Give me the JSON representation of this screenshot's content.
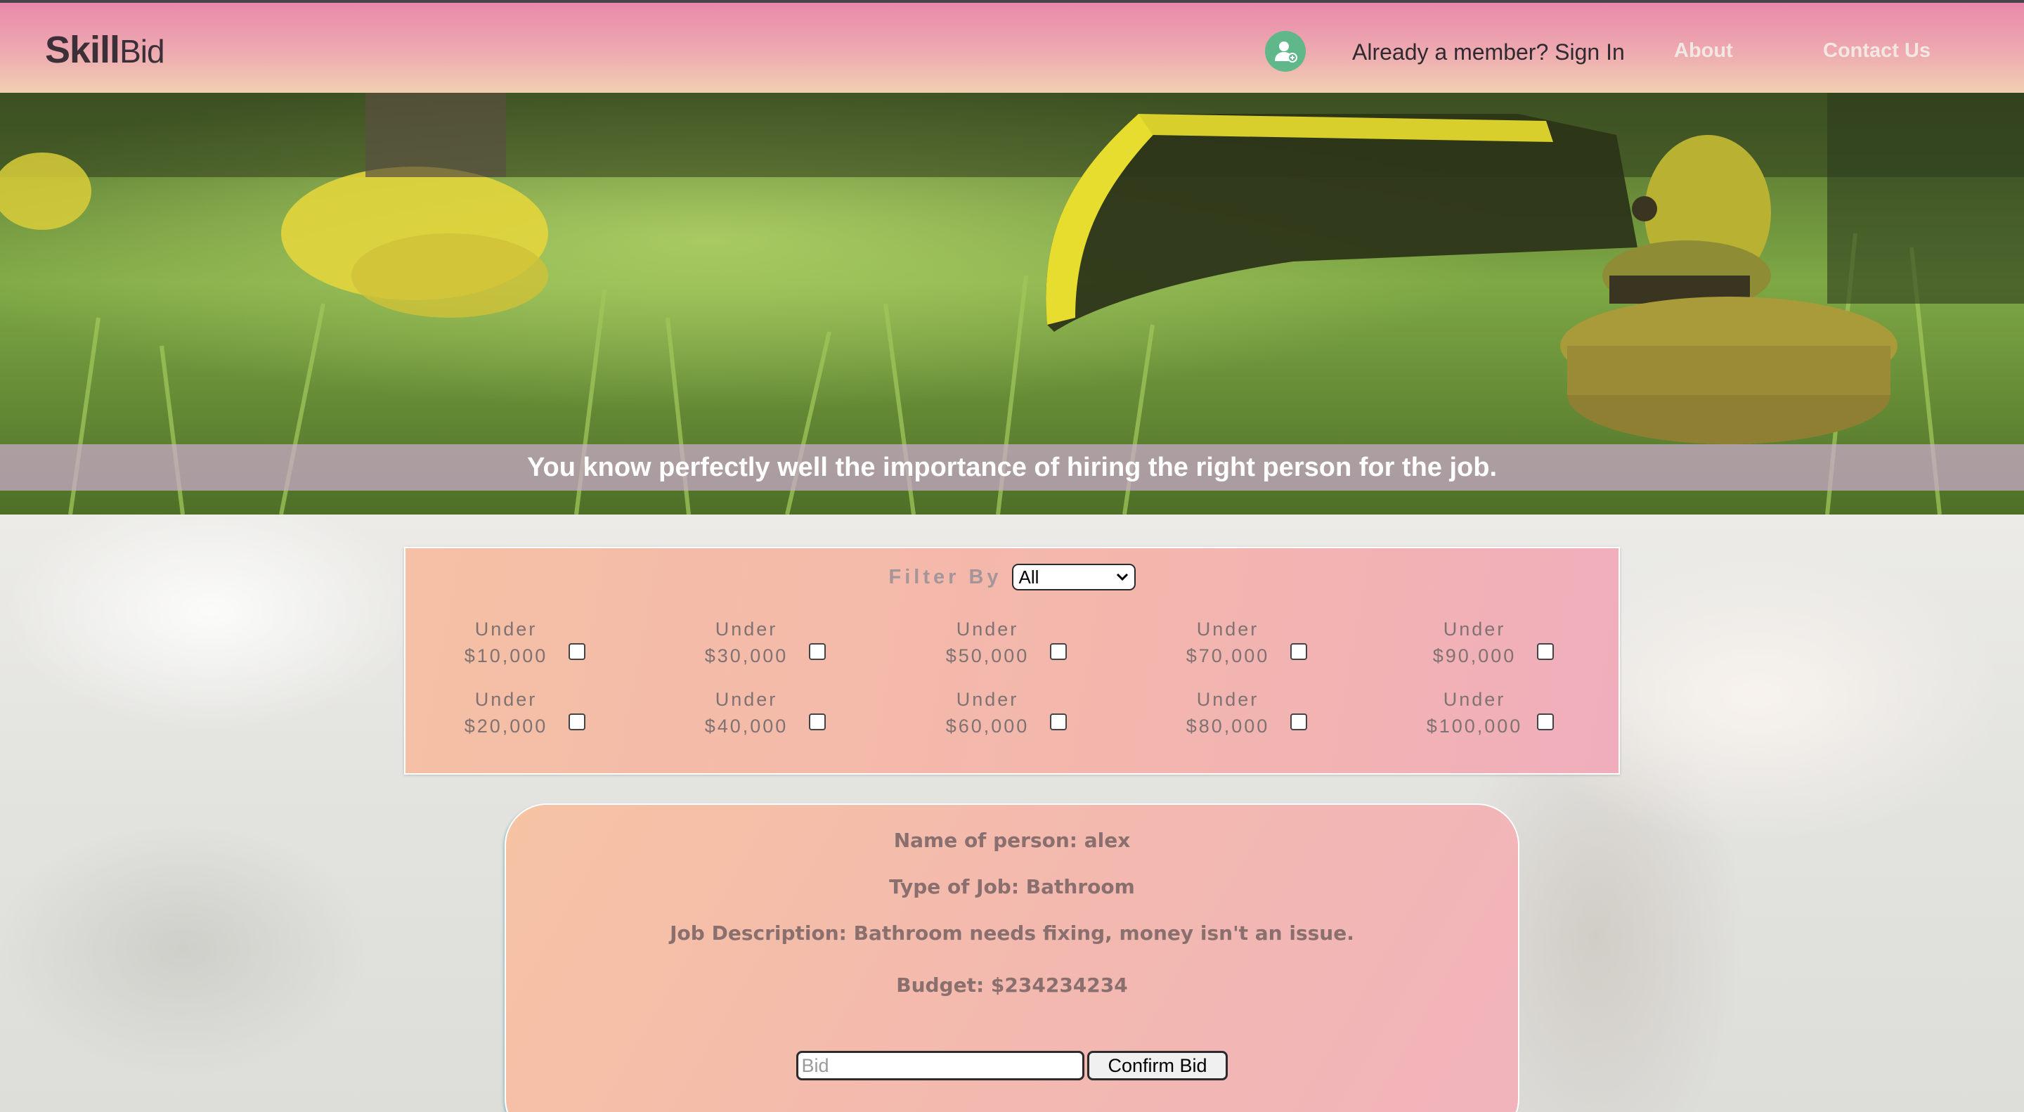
{
  "header": {
    "logo_bold": "Skill",
    "logo_light": "Bid",
    "avatar_icon": "user-add-icon",
    "sign_in": "Already a member? Sign In",
    "about": "About",
    "contact": "Contact Us"
  },
  "hero": {
    "banner_text": "You know perfectly well the importance of hiring the right person for the job."
  },
  "filter": {
    "label": "Filter By",
    "selected": "All",
    "options": [
      {
        "line1": "Under",
        "line2": "$10,000",
        "checked": false
      },
      {
        "line1": "Under",
        "line2": "$30,000",
        "checked": false
      },
      {
        "line1": "Under",
        "line2": "$50,000",
        "checked": false
      },
      {
        "line1": "Under",
        "line2": "$70,000",
        "checked": false
      },
      {
        "line1": "Under",
        "line2": "$90,000",
        "checked": false
      },
      {
        "line1": "Under",
        "line2": "$20,000",
        "checked": false
      },
      {
        "line1": "Under",
        "line2": "$40,000",
        "checked": false
      },
      {
        "line1": "Under",
        "line2": "$60,000",
        "checked": false
      },
      {
        "line1": "Under",
        "line2": "$80,000",
        "checked": false
      },
      {
        "line1": "Under",
        "line2": "$100,000",
        "checked": false
      }
    ]
  },
  "job": {
    "name": "Name of person: alex",
    "type": "Type of Job: Bathroom",
    "description": "Job Description: Bathroom needs fixing, money isn't an issue.",
    "budget": "Budget: $234234234",
    "bid_placeholder": "Bid",
    "confirm_label": "Confirm Bid"
  },
  "colors": {
    "header_top": "#e889ab",
    "header_bottom": "#f0cfb0",
    "panel": "#f3b6ad",
    "avatar": "#5fb78a"
  }
}
